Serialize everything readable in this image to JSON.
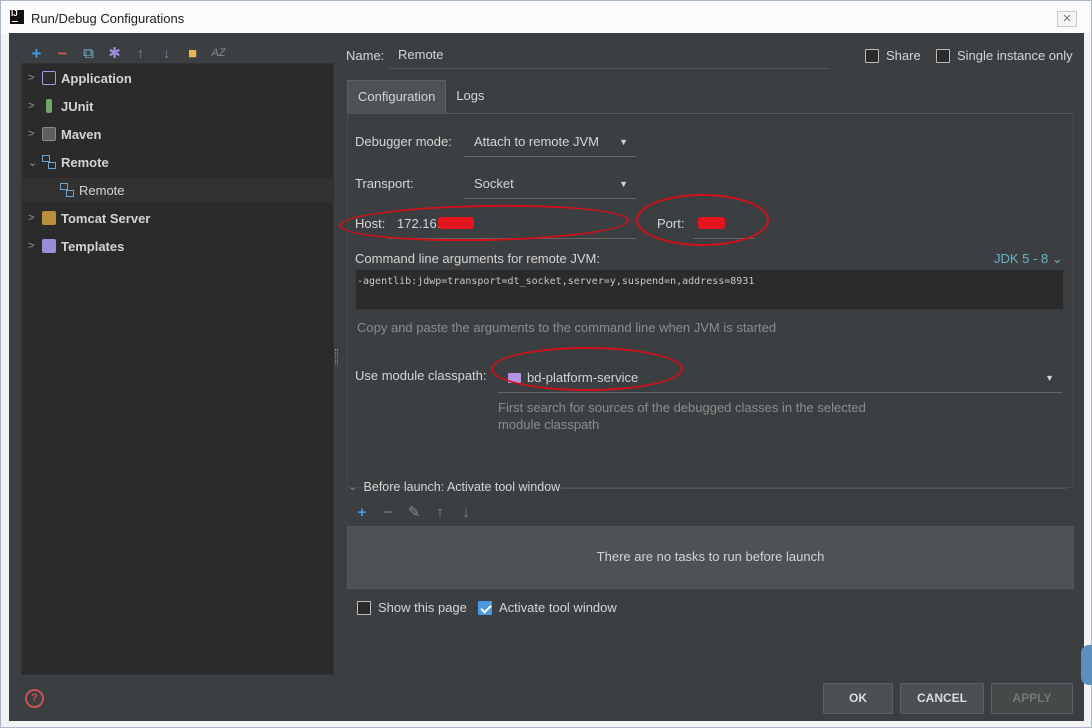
{
  "window": {
    "title": "Run/Debug Configurations",
    "logo": "IJ",
    "close_icon": "close-icon"
  },
  "toolbar": {
    "icons": [
      "add-icon",
      "remove-icon",
      "copy-icon",
      "gear-icon",
      "arrow-up-icon",
      "arrow-down-icon",
      "folder-icon",
      "sort-az-icon"
    ]
  },
  "tree": {
    "items": [
      {
        "label": "Application",
        "expanded": false
      },
      {
        "label": "JUnit",
        "expanded": false
      },
      {
        "label": "Maven",
        "expanded": false
      },
      {
        "label": "Remote",
        "expanded": true
      },
      {
        "label": "Remote",
        "child": true,
        "selected": true
      },
      {
        "label": "Tomcat Server",
        "expanded": false
      },
      {
        "label": "Templates",
        "expanded": false
      }
    ]
  },
  "config": {
    "name_label": "Name:",
    "name_value": "Remote",
    "share_label": "Share",
    "single_instance_label": "Single instance only",
    "tabs": [
      {
        "label": "Configuration",
        "active": true
      },
      {
        "label": "Logs",
        "active": false
      }
    ],
    "debugger_mode_label": "Debugger mode:",
    "debugger_mode_value": "Attach to remote JVM",
    "transport_label": "Transport:",
    "transport_value": "Socket",
    "host_label": "Host:",
    "host_value": "172.16.",
    "port_label": "Port:",
    "cmd_label": "Command line arguments for remote JVM:",
    "jdk_label": "JDK 5 - 8 ⌄",
    "cmd_value": "-agentlib:jdwp=transport=dt_socket,server=y,suspend=n,address=8931",
    "cmd_hint": "Copy and paste the arguments to the command line when JVM is started",
    "module_label": "Use module classpath:",
    "module_value": "bd-platform-service",
    "module_hint_1": "First search for sources of the debugged classes in the selected",
    "module_hint_2": "module classpath"
  },
  "before_launch": {
    "header": "Before launch: Activate tool window",
    "empty_text": "There are no tasks to run before launch",
    "show_page_label": "Show this page",
    "show_page_checked": false,
    "activate_label": "Activate tool window",
    "activate_checked": true
  },
  "buttons": {
    "ok": "OK",
    "cancel": "CANCEL",
    "apply": "APPLY"
  },
  "colors": {
    "background": "#3c3f41",
    "tree_bg": "#2b2b2b",
    "accent": "#4a9ae0",
    "annotation": "#d0101a"
  }
}
